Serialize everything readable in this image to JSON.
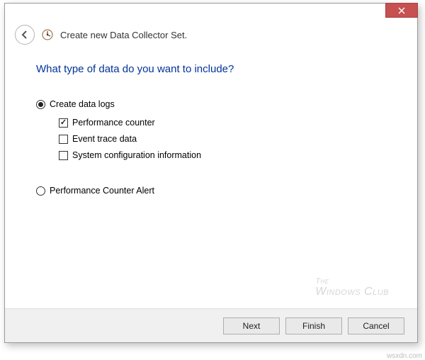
{
  "header": {
    "title": "Create new Data Collector Set."
  },
  "content": {
    "question": "What type of data do you want to include?",
    "option_create_logs": {
      "label": "Create data logs",
      "checked": true,
      "sub": {
        "perf_counter": {
          "label": "Performance counter",
          "checked": true
        },
        "event_trace": {
          "label": "Event trace data",
          "checked": false
        },
        "sys_config": {
          "label": "System configuration information",
          "checked": false
        }
      }
    },
    "option_perf_alert": {
      "label": "Performance Counter Alert",
      "checked": false
    }
  },
  "watermark": {
    "line1": "The",
    "line2": "Windows Club"
  },
  "buttons": {
    "next": "Next",
    "finish": "Finish",
    "cancel": "Cancel"
  },
  "source_tag": "wsxdn.com"
}
